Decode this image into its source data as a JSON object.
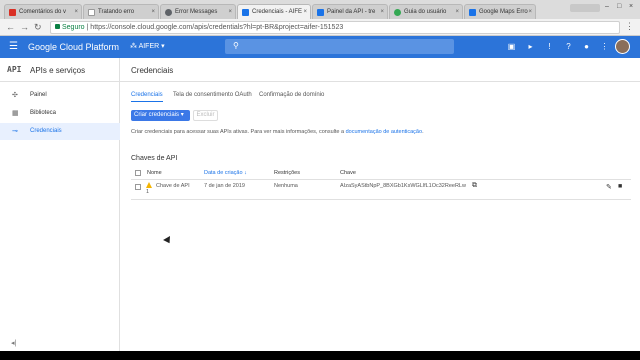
{
  "browser": {
    "tabs": [
      {
        "label": "Comentários do v",
        "color": "#d93025"
      },
      {
        "label": "Tratando erro",
        "color": "#ffffff"
      },
      {
        "label": "Error Messages",
        "color": "#5f6368"
      },
      {
        "label": "Credenciais - AIFE",
        "color": "#1a73e8",
        "active": true
      },
      {
        "label": "Painel da API - tre",
        "color": "#1a73e8"
      },
      {
        "label": "Guia do usuário",
        "color": "#34a853"
      },
      {
        "label": "Google Maps Erro",
        "color": "#1a73e8"
      }
    ],
    "secure_label": "Seguro",
    "url": "https://console.cloud.google.com/apis/credentials?hl=pt-BR&project=aifer-151523"
  },
  "header": {
    "title": "Google Cloud Platform",
    "project": "AIFER",
    "brand_color": "#2c74d9"
  },
  "sidebar": {
    "logo": "API",
    "title": "APIs e serviços",
    "items": [
      {
        "label": "Painel",
        "icon": "dashboard-icon"
      },
      {
        "label": "Biblioteca",
        "icon": "library-icon"
      },
      {
        "label": "Credenciais",
        "icon": "key-icon",
        "selected": true
      }
    ]
  },
  "main": {
    "title": "Credenciais",
    "tabs": [
      "Credenciais",
      "Tela de consentimento OAuth",
      "Confirmação de domínio"
    ],
    "create_button": "Criar credenciais",
    "delete_button": "Excluir",
    "info_text": "Criar credenciais para acessar suas APIs ativas. Para ver mais informações, consulte a",
    "info_link": "documentação de autenticação",
    "section_title": "Chaves de API",
    "columns": [
      "Nome",
      "Data de criação",
      "Restrições",
      "Chave"
    ],
    "rows": [
      {
        "name": "Chave de API",
        "name_suffix": "1",
        "created": "7 de jan de 2019",
        "restrictions": "Nenhuma",
        "key": "AIzaSyAStbNpP_8BXGb1KsWGLlfL1Oc32ReeRLw"
      }
    ]
  }
}
